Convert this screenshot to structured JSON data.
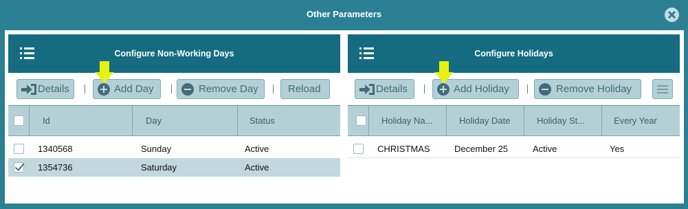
{
  "dialog": {
    "title": "Other Parameters",
    "close_icon": "close-circle-icon"
  },
  "left_panel": {
    "title": "Configure Non-Working Days",
    "menu_icon": "list-icon",
    "toolbar": {
      "details_label": "Details",
      "add_label": "Add Day",
      "remove_label": "Remove Day",
      "reload_label": "Reload"
    },
    "columns": [
      "Id",
      "Day",
      "Status"
    ],
    "rows": [
      {
        "id": "1340568",
        "day": "Sunday",
        "status": "Active",
        "checked": false,
        "selected": false
      },
      {
        "id": "1354736",
        "day": "Saturday",
        "status": "Active",
        "checked": true,
        "selected": true
      }
    ]
  },
  "right_panel": {
    "title": "Configure Holidays",
    "menu_icon": "list-icon",
    "toolbar": {
      "details_label": "Details",
      "add_label": "Add Holiday",
      "remove_label": "Remove Holiday",
      "more_icon": "hamburger-icon"
    },
    "columns": [
      "Holiday Na...",
      "Holiday Date",
      "Holiday St...",
      "Every Year"
    ],
    "rows": [
      {
        "name": "CHRISTMAS",
        "date": "December 25",
        "status": "Active",
        "every_year": "Yes",
        "checked": false
      }
    ]
  },
  "colors": {
    "frame": "#2b8093",
    "panel_header": "#156c80",
    "button_bg": "#b4d0d7",
    "highlight_arrow": "#e8f212",
    "selected_row": "#c2d8dd"
  }
}
